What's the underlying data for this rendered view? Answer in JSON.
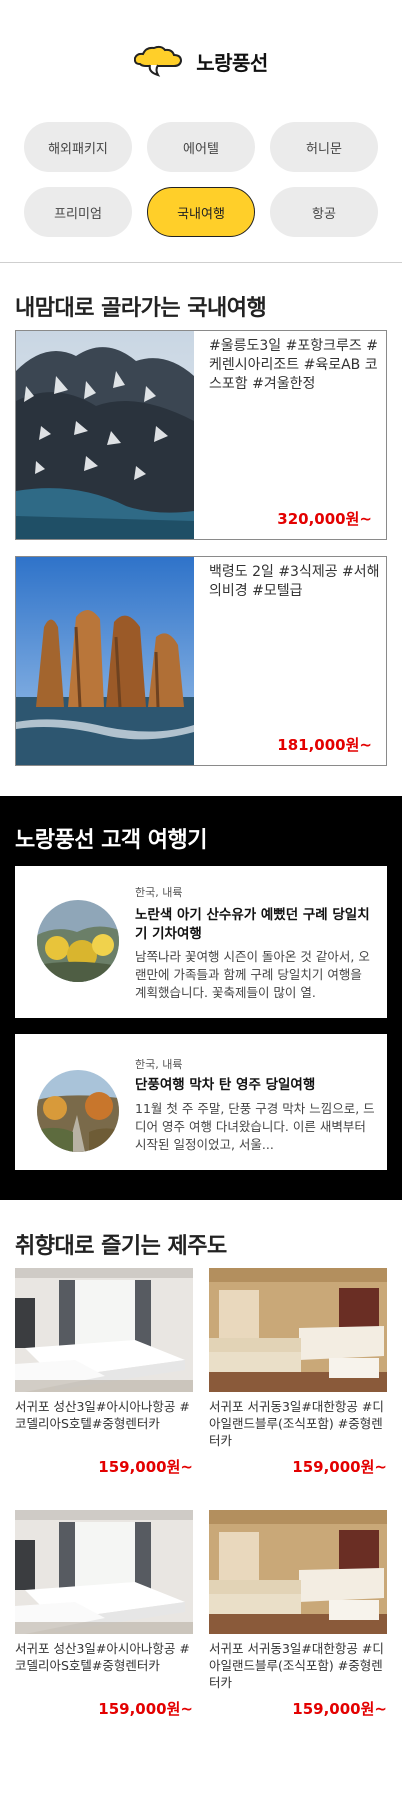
{
  "brand": {
    "name": "노랑풍선",
    "accent": "#ffcf29"
  },
  "categories": [
    {
      "label": "해외패키지",
      "active": false
    },
    {
      "label": "에어텔",
      "active": false
    },
    {
      "label": "허니문",
      "active": false
    },
    {
      "label": "프리미엄",
      "active": false
    },
    {
      "label": "국내여행",
      "active": true
    },
    {
      "label": "항공",
      "active": false
    }
  ],
  "domestic": {
    "title": "내맘대로 골라가는 국내여행",
    "items": [
      {
        "tags": "#울릉도3일 #포항크루즈 #케렌시아리조트 #육로AB 코스포함 #겨울한정",
        "price": "320,000원~"
      },
      {
        "tags": "백령도 2일 #3식제공 #서해의비경 #모텔급",
        "price": "181,000원~"
      }
    ]
  },
  "reviews": {
    "title": "노랑풍선 고객 여행기",
    "items": [
      {
        "region": "한국, 내륙",
        "headline": "노란색 아기 산수유가 예뻤던 구례 당일치기 기차여행",
        "body": "남쪽나라 꽃여행 시즌이 돌아온 것 같아서, 오랜만에 가족들과 함께 구례 당일치기 여행을 계획했습니다. 꽃축제들이 많이 열."
      },
      {
        "region": "한국, 내륙",
        "headline": "단풍여행 막차 탄 영주 당일여행",
        "body": "11월 첫 주 주말, 단풍 구경 막차 느낌으로, 드디어 영주 여행 다녀왔습니다. 이른 새벽부터 시작된 일정이었고, 서울..."
      }
    ]
  },
  "jeju": {
    "title": "취향대로 즐기는 제주도",
    "items": [
      {
        "desc": "서귀포 성산3일#아시아나항공 #코델리아S호텔#중형렌터카",
        "price": "159,000원~"
      },
      {
        "desc": "서귀포 서귀동3일#대한항공 #디아일랜드블루(조식포함) #중형렌터카",
        "price": "159,000원~"
      },
      {
        "desc": "서귀포 성산3일#아시아나항공 #코델리아S호텔#중형렌터카",
        "price": "159,000원~"
      },
      {
        "desc": "서귀포 서귀동3일#대한항공 #디아일랜드블루(조식포함) #중형렌터카",
        "price": "159,000원~"
      }
    ]
  }
}
